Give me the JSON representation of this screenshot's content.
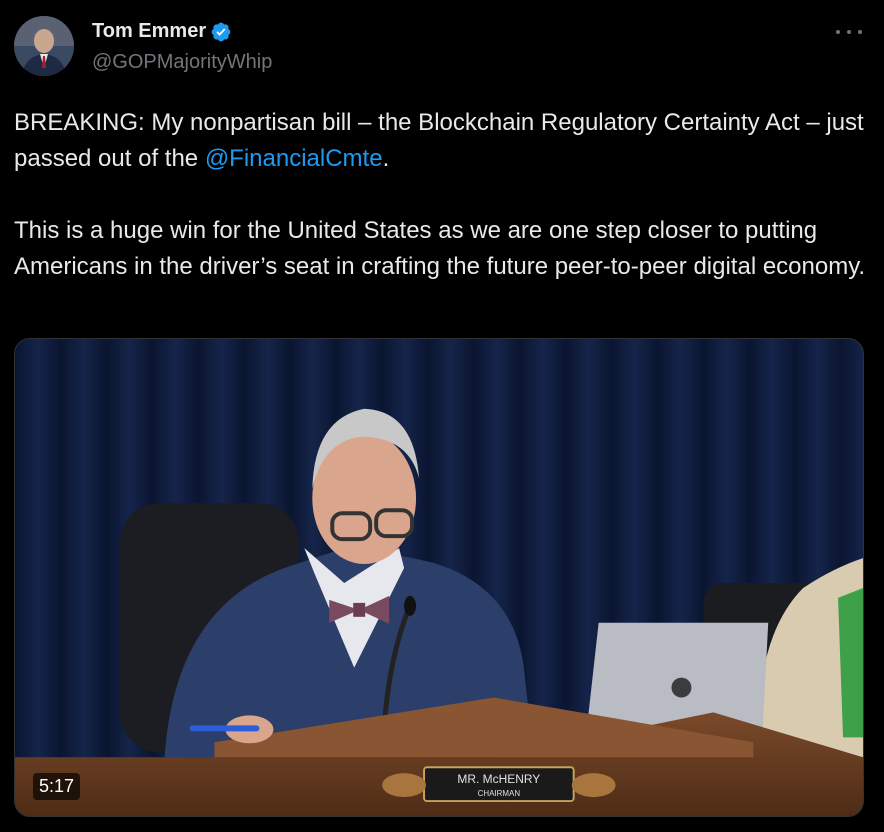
{
  "tweet": {
    "author": {
      "display_name": "Tom Emmer",
      "handle": "@GOPMajorityWhip",
      "verified_icon": "verified-badge-icon"
    },
    "text_part1": "BREAKING: My nonpartisan bill – the Blockchain Regulatory Certainty Act – just passed out of the ",
    "mention": "@FinancialCmte",
    "text_part2": ".\n\nThis is a huge win for the United States as we are one step closer to putting Americans in the driver’s seat in crafting the future peer-to-peer digital economy.",
    "media": {
      "type": "video",
      "duration": "5:17",
      "nameplate_name": "MR. McHENRY",
      "nameplate_title": "CHAIRMAN"
    }
  },
  "colors": {
    "background": "#000000",
    "text": "#e7e9ea",
    "secondary": "#71767b",
    "link": "#1d9bf0",
    "verified": "#1d9bf0"
  }
}
